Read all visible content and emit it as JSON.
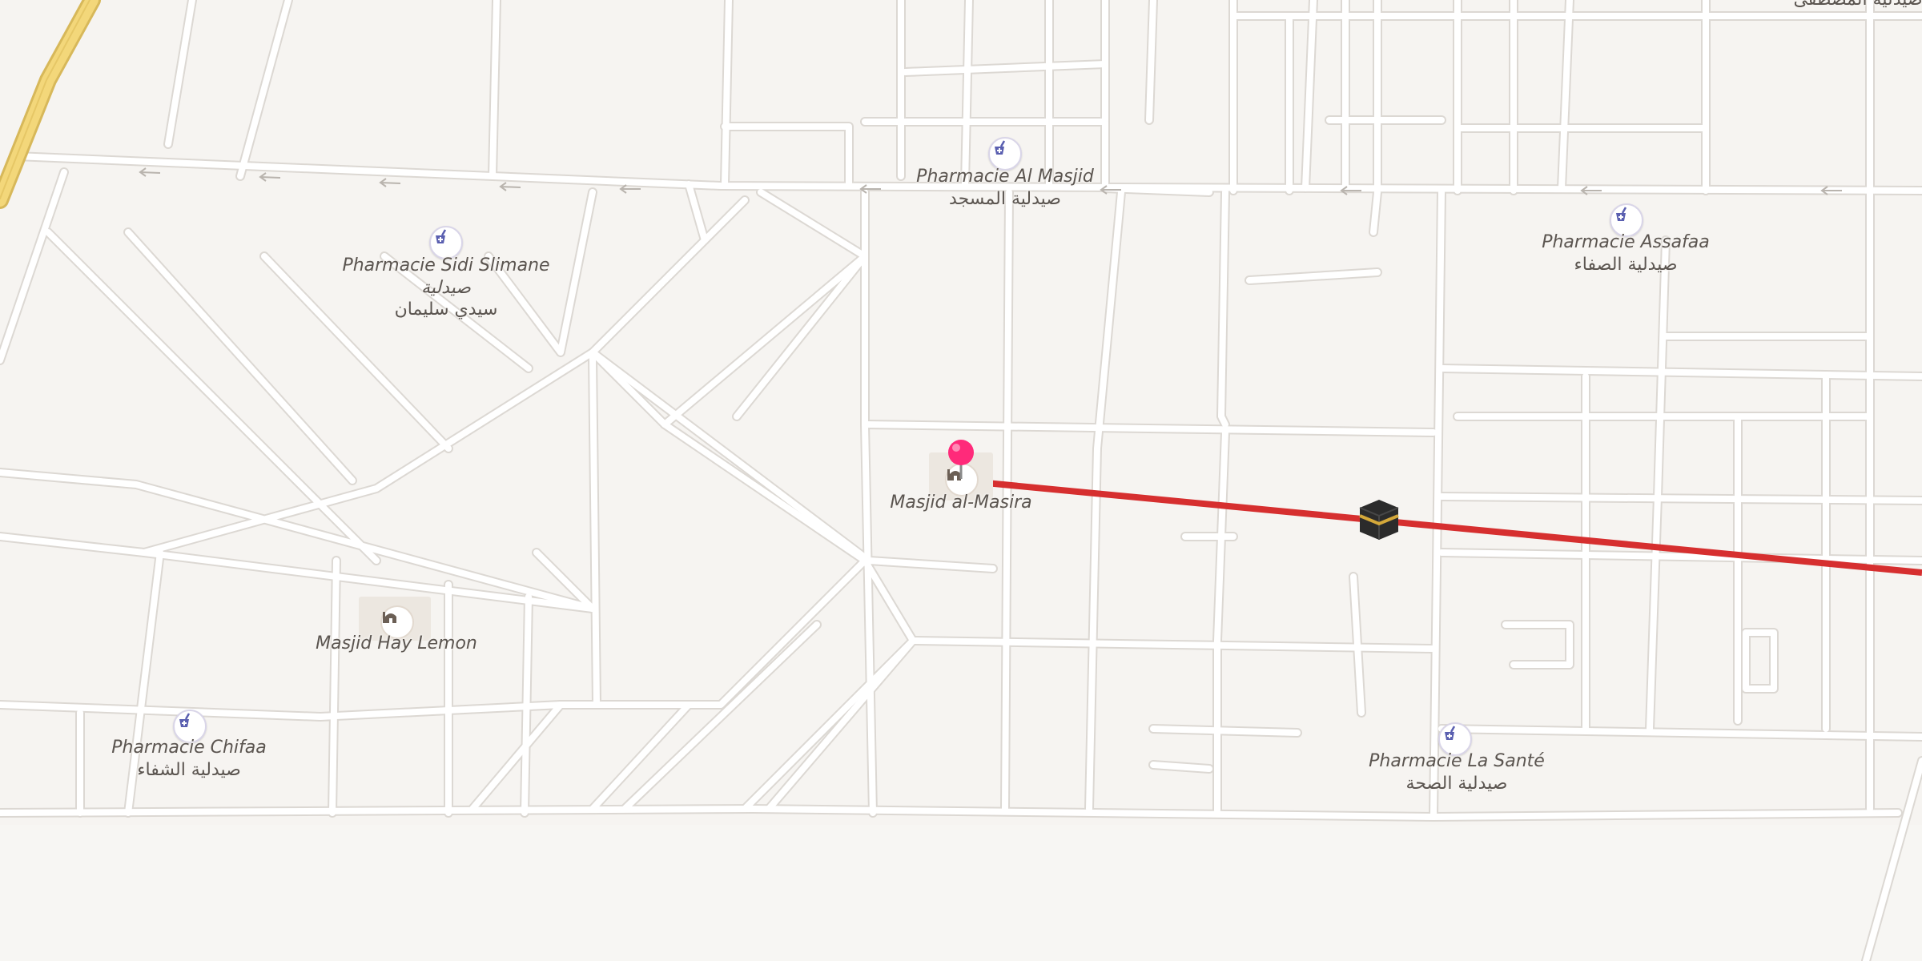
{
  "map": {
    "colors": {
      "background": "#f6f4f1",
      "street": "#ffffff",
      "street_casing": "#dcd8d3",
      "highway": "#f3d77a",
      "route_line": "#d62f2f",
      "pin": "#ff2a7a",
      "pharmacy_icon": "#5a5fb0",
      "label": "#5b5550"
    },
    "pois": {
      "pharmacie_al_masjid": {
        "name_latin": "Pharmacie Al Masjid",
        "name_arabic": "صيدلية المسجد",
        "icon": "pharmacy-icon"
      },
      "pharmacie_sidi_slimane": {
        "name_latin": "Pharmacie Sidi Slimane صيدلية",
        "name_arabic": "سيدي سليمان",
        "icon": "pharmacy-icon"
      },
      "pharmacie_assafaa": {
        "name_latin": "Pharmacie Assafaa",
        "name_arabic": "صيدلية الصفاء",
        "icon": "pharmacy-icon"
      },
      "masjid_al_masira": {
        "name_latin": "Masjid al-Masira",
        "icon": "mosque-icon"
      },
      "masjid_hay_lemon": {
        "name_latin": "Masjid Hay Lemon",
        "icon": "mosque-icon"
      },
      "pharmacie_chifaa": {
        "name_latin": "Pharmacie Chifaa",
        "name_arabic": "صيدلية الشفاء",
        "icon": "pharmacy-icon"
      },
      "pharmacie_la_sante": {
        "name_latin": "Pharmacie La Santé",
        "name_arabic": "صيدلية الصحة",
        "icon": "pharmacy-icon"
      },
      "top_right_partial": {
        "name_arabic": "صيدلية المصطفى"
      }
    },
    "route": {
      "destination_icon": "kaaba-icon",
      "start_marker": "location-pin-icon"
    }
  }
}
